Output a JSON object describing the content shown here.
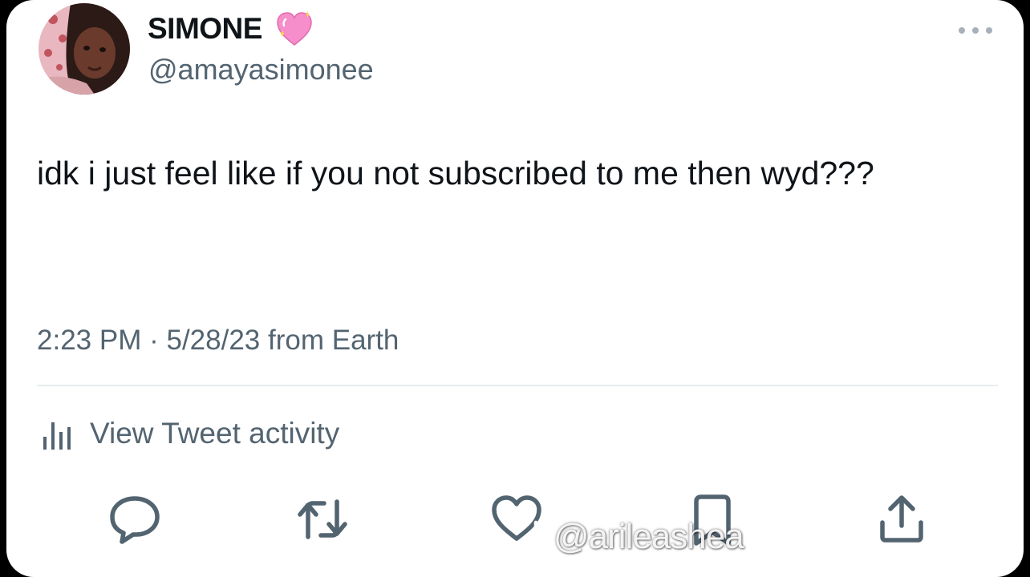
{
  "author": {
    "display_name": "SIMONE",
    "handle": "@amayasimonee",
    "name_emoji": "sparkling-heart-icon",
    "avatar": "profile-photo"
  },
  "tweet": {
    "text": "idk i just feel like if you not subscribed to me then wyd???",
    "time": "2:23 PM",
    "separator": "·",
    "date": "5/28/23",
    "source": "from Earth"
  },
  "activity": {
    "icon": "bar-chart-icon",
    "label": "View Tweet activity"
  },
  "actions": [
    {
      "name": "reply",
      "icon": "reply-icon"
    },
    {
      "name": "retweet",
      "icon": "retweet-icon"
    },
    {
      "name": "like",
      "icon": "heart-outline-icon"
    },
    {
      "name": "bookmark",
      "icon": "bookmark-icon"
    },
    {
      "name": "share",
      "icon": "share-icon"
    }
  ],
  "watermark": {
    "icon": "tiktok-icon",
    "text": "@arileashea"
  },
  "colors": {
    "text_primary": "#0f1419",
    "text_secondary": "#536471",
    "divider": "#e8ecef",
    "heart_pink": "#f58ecb",
    "background": "#ffffff"
  }
}
